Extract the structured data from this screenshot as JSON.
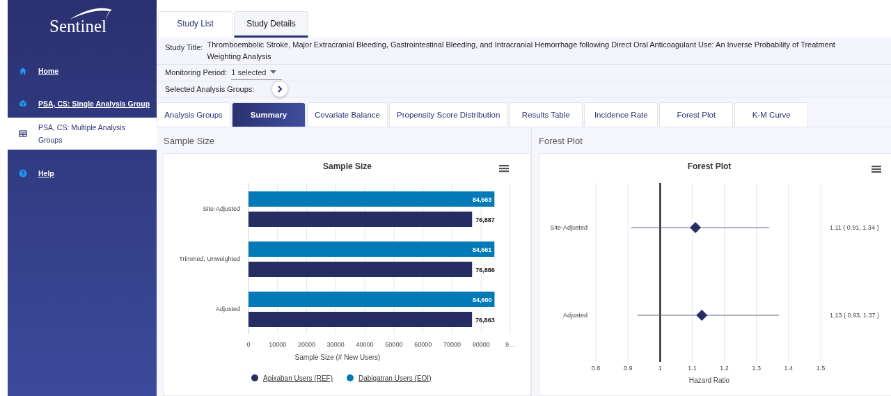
{
  "sidebar": {
    "logo": "Sentinel",
    "items": [
      {
        "label": "Home",
        "selected": false
      },
      {
        "label": "PSA, CS: Single Analysis Group",
        "selected": false
      },
      {
        "label": "PSA, CS: Multiple Analysis Groups",
        "selected": true
      },
      {
        "label": "Help",
        "selected": false
      }
    ]
  },
  "top_tabs": [
    {
      "label": "Study List",
      "selected": false
    },
    {
      "label": "Study Details",
      "selected": true
    }
  ],
  "study": {
    "title_label": "Study Title:",
    "title": "Thromboembolic Stroke, Major Extracranial Bleeding, Gastrointestinal Bleeding, and Intracranial Hemorrhage following Direct Oral Anticoagulant Use: An Inverse Probability of Treatment Weighting Analysis",
    "monitoring_label": "Monitoring Period:",
    "monitoring_value": "1 selected",
    "groups_label": "Selected Analysis Groups:"
  },
  "analysis_tabs": [
    {
      "label": "Analysis Groups",
      "selected": false
    },
    {
      "label": "Summary",
      "selected": true
    },
    {
      "label": "Covariate Balance",
      "selected": false
    },
    {
      "label": "Propensity Score Distribution",
      "selected": false
    },
    {
      "label": "Results Table",
      "selected": false
    },
    {
      "label": "Incidence Rate",
      "selected": false
    },
    {
      "label": "Forest Plot",
      "selected": false
    },
    {
      "label": "K-M Curve",
      "selected": false
    }
  ],
  "panels": [
    {
      "heading": "Sample Size",
      "chart_data": {
        "type": "bar",
        "orientation": "horizontal",
        "title": "Sample Size",
        "xlabel": "Sample Size (# New Users)",
        "categories": [
          "Site-Adjusted",
          "Trimmed, Unweighted",
          "Adjusted"
        ],
        "grid": true,
        "legend": "bottom",
        "series": [
          {
            "name": "Apixaban Users (REF)",
            "color": "#252d62",
            "values": [
              76887,
              76886,
              76863
            ],
            "value_labels": [
              "76,887",
              "76,886",
              "76,863"
            ]
          },
          {
            "name": "Dabigatran Users (EOI)",
            "color": "#027ab8",
            "values": [
              84563,
              84561,
              84600
            ],
            "value_labels": [
              "84,563",
              "84,561",
              "84,600"
            ]
          }
        ],
        "xlim": [
          0,
          90000
        ],
        "xticks": [
          0,
          10000,
          20000,
          30000,
          40000,
          50000,
          60000,
          70000,
          80000,
          {
            "value": 90000,
            "label": "9…"
          }
        ]
      }
    },
    {
      "heading": "Forest Plot",
      "chart_data": {
        "type": "scatter",
        "orientation": "horizontal",
        "title": "Forest Plot",
        "xlabel": "Hazard Ratio",
        "categories": [
          "Site-Adjusted",
          "Adjusted"
        ],
        "grid": true,
        "series": [
          {
            "color": "#252d62",
            "values": [
              1.11,
              1.13
            ],
            "value_labels": [
              "1.11 ( 0.91, 1.34 )",
              "1.13 ( 0.93, 1.37 )"
            ],
            "errors": [
              [
                0.91,
                1.34
              ],
              [
                0.93,
                1.37
              ]
            ]
          }
        ],
        "xlim": [
          0.8,
          1.5
        ],
        "xticks": [
          {
            "value": 0.8,
            "label": "0.8"
          },
          {
            "value": 0.9,
            "label": "0.9"
          },
          {
            "value": 1,
            "label": "1"
          },
          {
            "value": 1.1,
            "label": "1.1"
          },
          {
            "value": 1.2,
            "label": "1.2"
          },
          {
            "value": 1.3,
            "label": "1.3"
          },
          {
            "value": 1.4,
            "label": "1.4"
          },
          {
            "value": 1.5,
            "label": "1.5"
          }
        ],
        "ref_lines": [
          {
            "axis": "x",
            "value": 1
          }
        ]
      }
    }
  ]
}
